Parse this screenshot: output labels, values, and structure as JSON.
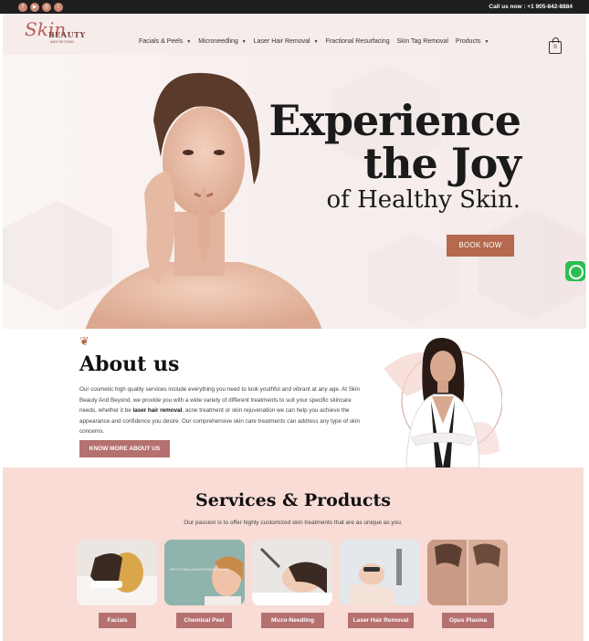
{
  "topbar": {
    "social_icons": [
      "facebook-icon",
      "youtube-icon",
      "instagram-icon",
      "twitter-icon"
    ],
    "call_text": "Call us now : +1 905-842-8884"
  },
  "logo": {
    "script": "Skin",
    "word": "BEAUTY",
    "tagline": "AND BEYOND"
  },
  "nav": [
    {
      "label": "Facials & Peels",
      "dropdown": true
    },
    {
      "label": "Microneedling",
      "dropdown": true
    },
    {
      "label": "Laser Hair Removal",
      "dropdown": true
    },
    {
      "label": "Fractional Resurfacing",
      "dropdown": false
    },
    {
      "label": "Skin Tag Removal",
      "dropdown": false
    },
    {
      "label": "Products",
      "dropdown": true
    }
  ],
  "cart": {
    "count": "0"
  },
  "hero": {
    "line1": "Experience",
    "line2": "the Joy",
    "line3": "of Healthy Skin.",
    "button": "BOOK NOW"
  },
  "about": {
    "title": "About us",
    "text_before": "Our cosmetic high quality services include everything you need to look youthful and vibrant at any age. At Skin Beauty And Beyond, we provide you with a wide variety of different treatments to suit your specific skincare needs, whether it be ",
    "text_bold": "laser hair removal",
    "text_after": ", acne treatment or skin rejuvenation we can help you achieve the appearance and confidence you desire. Our comprehensive skin care treatments can address any type of skin concerns.",
    "button": "KNOW MORE ABOUT US"
  },
  "services": {
    "title": "Services & Products",
    "subtitle": "Our passion is to offer highly customized skin treatments that are as unique as you.",
    "items": [
      {
        "label": "Facials"
      },
      {
        "label": "Chemical Peel",
        "overlay": "SPOTS MELASMA PIGMENTATION"
      },
      {
        "label": "Micro-Needling"
      },
      {
        "label": "Laser Hair Removal"
      },
      {
        "label": "Opus Plasma"
      }
    ]
  },
  "colors": {
    "accent": "#b5694f",
    "rose": "#b57170",
    "blush": "#f8dcd5",
    "whatsapp": "#2dbe53"
  }
}
